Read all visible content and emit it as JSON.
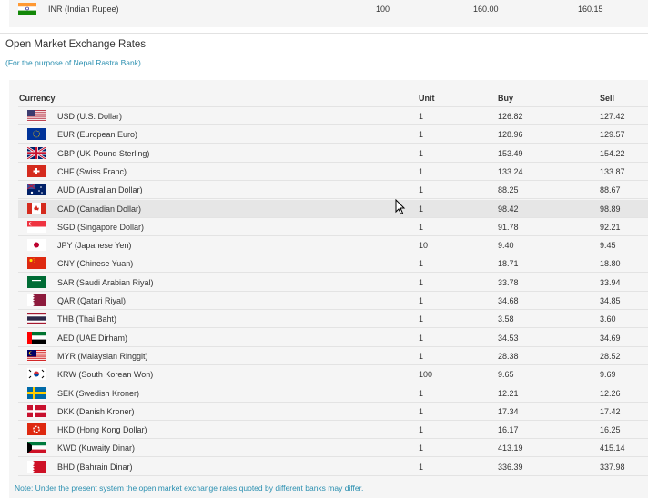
{
  "top_row": {
    "code": "IN",
    "name": "INR (Indian Rupee)",
    "unit": "100",
    "buy": "160.00",
    "sell": "160.15"
  },
  "section": {
    "title": "Open Market Exchange Rates",
    "subtitle": "(For the purpose of Nepal Rastra Bank)"
  },
  "table": {
    "headers": {
      "currency": "Currency",
      "unit": "Unit",
      "buy": "Buy",
      "sell": "Sell"
    },
    "highlighted_row": 5,
    "rows": [
      {
        "code": "US",
        "name": "USD (U.S. Dollar)",
        "unit": "1",
        "buy": "126.82",
        "sell": "127.42"
      },
      {
        "code": "EU",
        "name": "EUR (European Euro)",
        "unit": "1",
        "buy": "128.96",
        "sell": "129.57"
      },
      {
        "code": "GB",
        "name": "GBP (UK Pound Sterling)",
        "unit": "1",
        "buy": "153.49",
        "sell": "154.22"
      },
      {
        "code": "CH",
        "name": "CHF (Swiss Franc)",
        "unit": "1",
        "buy": "133.24",
        "sell": "133.87"
      },
      {
        "code": "AU",
        "name": "AUD (Australian Dollar)",
        "unit": "1",
        "buy": "88.25",
        "sell": "88.67"
      },
      {
        "code": "CA",
        "name": "CAD (Canadian Dollar)",
        "unit": "1",
        "buy": "98.42",
        "sell": "98.89"
      },
      {
        "code": "SG",
        "name": "SGD (Singapore Dollar)",
        "unit": "1",
        "buy": "91.78",
        "sell": "92.21"
      },
      {
        "code": "JP",
        "name": "JPY (Japanese Yen)",
        "unit": "10",
        "buy": "9.40",
        "sell": "9.45"
      },
      {
        "code": "CN",
        "name": "CNY (Chinese Yuan)",
        "unit": "1",
        "buy": "18.71",
        "sell": "18.80"
      },
      {
        "code": "SA",
        "name": "SAR (Saudi Arabian Riyal)",
        "unit": "1",
        "buy": "33.78",
        "sell": "33.94"
      },
      {
        "code": "QA",
        "name": "QAR (Qatari Riyal)",
        "unit": "1",
        "buy": "34.68",
        "sell": "34.85"
      },
      {
        "code": "TH",
        "name": "THB (Thai Baht)",
        "unit": "1",
        "buy": "3.58",
        "sell": "3.60"
      },
      {
        "code": "AE",
        "name": "AED (UAE Dirham)",
        "unit": "1",
        "buy": "34.53",
        "sell": "34.69"
      },
      {
        "code": "MY",
        "name": "MYR (Malaysian Ringgit)",
        "unit": "1",
        "buy": "28.38",
        "sell": "28.52"
      },
      {
        "code": "KR",
        "name": "KRW (South Korean Won)",
        "unit": "100",
        "buy": "9.65",
        "sell": "9.69"
      },
      {
        "code": "SE",
        "name": "SEK (Swedish Kroner)",
        "unit": "1",
        "buy": "12.21",
        "sell": "12.26"
      },
      {
        "code": "DK",
        "name": "DKK (Danish Kroner)",
        "unit": "1",
        "buy": "17.34",
        "sell": "17.42"
      },
      {
        "code": "HK",
        "name": "HKD (Hong Kong Dollar)",
        "unit": "1",
        "buy": "16.17",
        "sell": "16.25"
      },
      {
        "code": "KW",
        "name": "KWD (Kuwaity Dinar)",
        "unit": "1",
        "buy": "413.19",
        "sell": "415.14"
      },
      {
        "code": "BH",
        "name": "BHD (Bahrain Dinar)",
        "unit": "1",
        "buy": "336.39",
        "sell": "337.98"
      }
    ]
  },
  "note": "Note: Under the present system the open market exchange rates quoted by different banks may differ."
}
